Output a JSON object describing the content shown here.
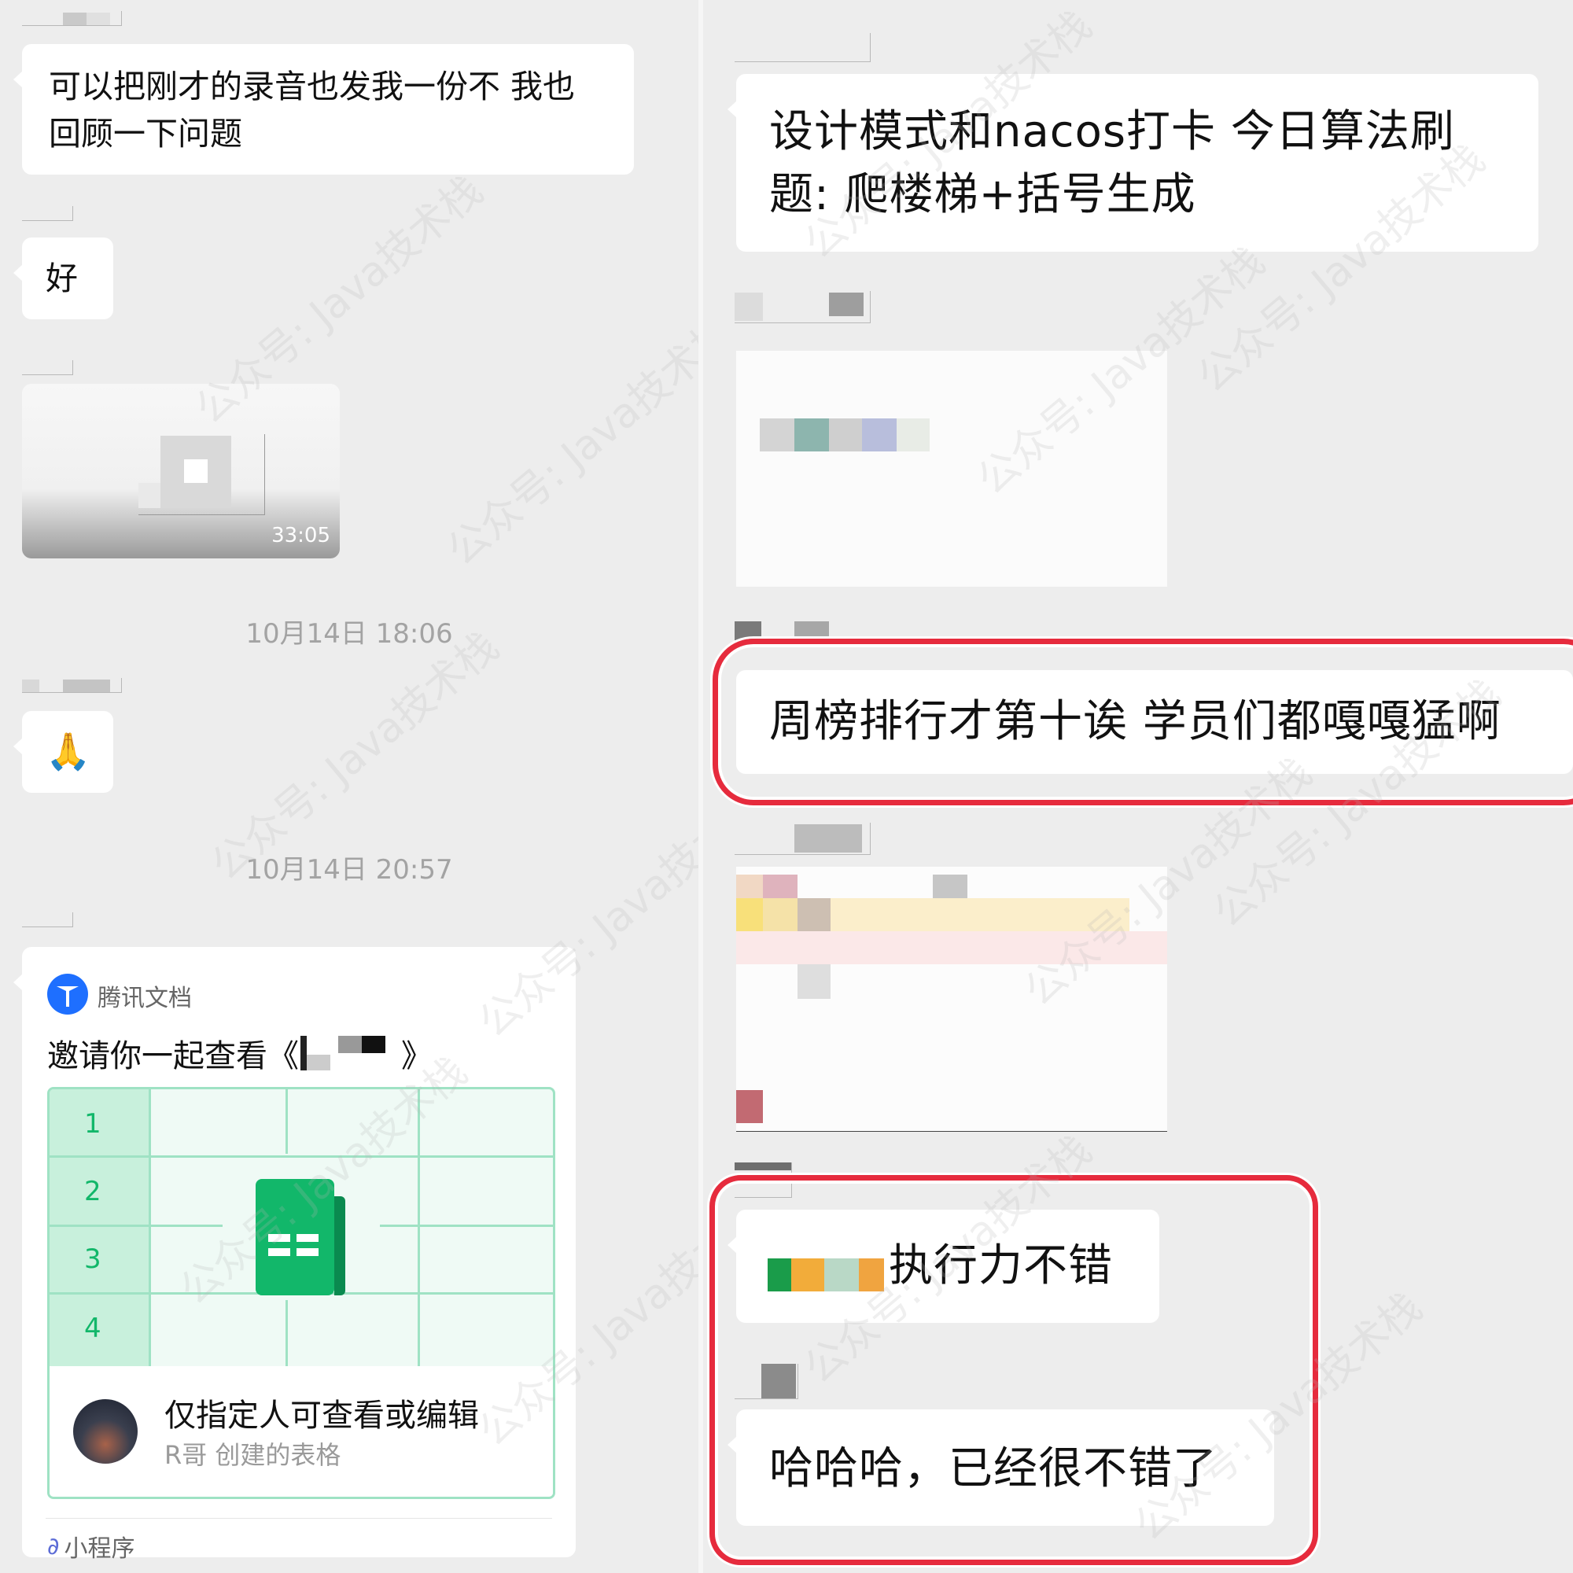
{
  "left": {
    "msg1": {
      "text_line1": "可以把刚才的录音也发我一份不 我也",
      "text_line2": "回顾一下问题"
    },
    "msg2": {
      "text": "好"
    },
    "video": {
      "duration": "33:05"
    },
    "time1": "10月14日 18:06",
    "msg3": {
      "emoji": "🙏"
    },
    "time2": "10月14日 20:57",
    "doc_card": {
      "app_name": "腾讯文档",
      "invite_text_prefix": "邀请你一起查看《",
      "invite_text_suffix": "》",
      "row_numbers": [
        "1",
        "2",
        "3",
        "4"
      ],
      "permission": "仅指定人可查看或编辑",
      "creator": "R哥 创建的表格",
      "footer": "小程序"
    }
  },
  "right": {
    "msg1": {
      "text_line1": "设计模式和nacos打卡  今日算法刷",
      "text_line2": "题: 爬楼梯+括号生成"
    },
    "msg2": {
      "text": "周榜排行才第十诶 学员们都嘎嘎猛啊"
    },
    "msg3": {
      "text": "执行力不错"
    },
    "msg4": {
      "text": "哈哈哈，已经很不错了"
    }
  },
  "watermark": "公众号: Java技术栈",
  "colors": {
    "background": "#ededed",
    "bubble": "#ffffff",
    "highlight": "#e62b3d",
    "doc_green": "#12b76a",
    "doc_blue": "#1e6fff"
  }
}
